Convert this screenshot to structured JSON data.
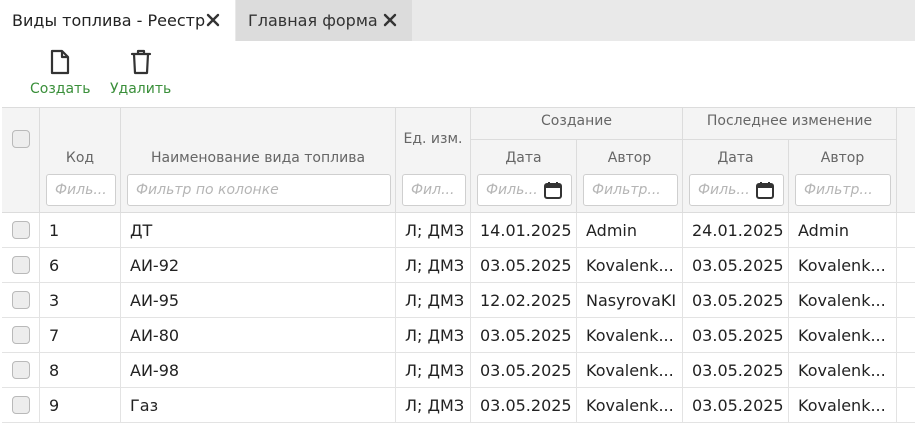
{
  "tabs": [
    {
      "label": "Виды топлива - Реестр",
      "active": true
    },
    {
      "label": "Главная форма",
      "active": false
    }
  ],
  "toolbar": {
    "create_label": "Создать",
    "delete_label": "Удалить"
  },
  "grid": {
    "headers": {
      "code": "Код",
      "name": "Наименование вида топлива",
      "unit": "Ед. изм.",
      "created_group": "Создание",
      "modified_group": "Последнее изменение",
      "created_date": "Дата",
      "created_author": "Автор",
      "modified_date": "Дата",
      "modified_author": "Автор"
    },
    "filters": {
      "code": "Филь...",
      "name": "Фильтр по колонке",
      "unit": "Фил...",
      "created_date": "Филь...",
      "created_author": "Фильтр...",
      "modified_date": "Филь...",
      "modified_author": "Фильтр..."
    },
    "rows": [
      {
        "code": "1",
        "name": "ДТ",
        "unit": "Л; ДМЗ",
        "created_date": "14.01.2025",
        "created_author": "Admin",
        "modified_date": "24.01.2025",
        "modified_author": "Admin"
      },
      {
        "code": "6",
        "name": "АИ-92",
        "unit": "Л; ДМЗ",
        "created_date": "03.05.2025",
        "created_author": "Kovalenk...",
        "modified_date": "03.05.2025",
        "modified_author": "Kovalenk..."
      },
      {
        "code": "3",
        "name": "АИ-95",
        "unit": "Л; ДМЗ",
        "created_date": "12.02.2025",
        "created_author": "NasyrovaKI",
        "modified_date": "03.05.2025",
        "modified_author": "Kovalenk..."
      },
      {
        "code": "7",
        "name": "АИ-80",
        "unit": "Л; ДМЗ",
        "created_date": "03.05.2025",
        "created_author": "Kovalenk...",
        "modified_date": "03.05.2025",
        "modified_author": "Kovalenk..."
      },
      {
        "code": "8",
        "name": "АИ-98",
        "unit": "Л; ДМЗ",
        "created_date": "03.05.2025",
        "created_author": "Kovalenk...",
        "modified_date": "03.05.2025",
        "modified_author": "Kovalenk..."
      },
      {
        "code": "9",
        "name": "Газ",
        "unit": "Л; ДМЗ",
        "created_date": "03.05.2025",
        "created_author": "Kovalenk...",
        "modified_date": "03.05.2025",
        "modified_author": "Kovalenk..."
      }
    ]
  },
  "colors": {
    "accent_green": "#3a8f3a",
    "header_bg": "#f4f4f4",
    "tabbar_bg": "#e9e9e9"
  },
  "icons": {
    "create": "file-icon",
    "delete": "trash-icon",
    "tab_close": "close-icon",
    "date_filter": "calendar-icon"
  }
}
